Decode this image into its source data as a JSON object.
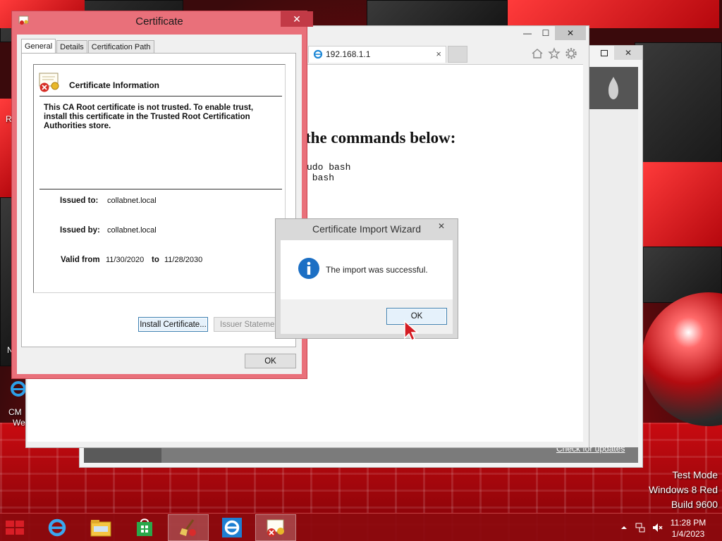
{
  "desktop": {
    "icon_labels": [
      "R",
      "N",
      "CM",
      "We"
    ],
    "watermark": [
      "Test Mode",
      "Windows 8 Red",
      "Build 9600"
    ]
  },
  "browser": {
    "tab_title": "192.168.1.1",
    "tab_close": "×",
    "heading": "the commands below:",
    "code_lines": [
      "udo bash",
      " bash"
    ],
    "minimize": "—",
    "maximize": "☐",
    "close": "✕"
  },
  "back_app": {
    "link": "Check for updates",
    "close": "✕"
  },
  "cert_dialog": {
    "title": "Certificate",
    "close": "✕",
    "tabs": [
      "General",
      "Details",
      "Certification Path"
    ],
    "info_heading": "Certificate Information",
    "message": "This CA Root certificate is not trusted. To enable trust, install this certificate in the Trusted Root Certification Authorities store.",
    "issued_to_label": "Issued to:",
    "issued_to_value": "collabnet.local",
    "issued_by_label": "Issued by:",
    "issued_by_value": "collabnet.local",
    "valid_from_label": "Valid from",
    "valid_from_value": "11/30/2020",
    "to_label": "to",
    "valid_to_value": "11/28/2030",
    "install_button": "Install Certificate...",
    "issuer_button": "Issuer Statement",
    "ok_button": "OK"
  },
  "wizard_dialog": {
    "title": "Certificate Import Wizard",
    "close": "✕",
    "message": "The import was successful.",
    "ok_button": "OK"
  },
  "taskbar": {
    "time": "11:28 PM",
    "date": "1/4/2023"
  },
  "colors": {
    "cert_frame": "#e9707a",
    "taskbar": "#8c0a0e",
    "info_blue": "#1c6fc4"
  }
}
